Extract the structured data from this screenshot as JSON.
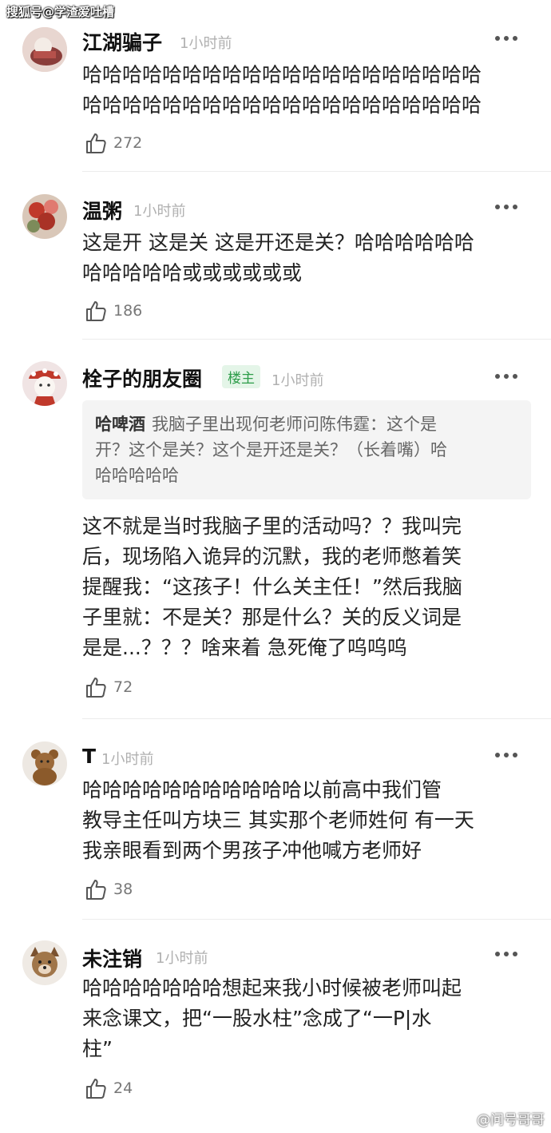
{
  "watermarks": {
    "top": "搜狐号@学渣爱吐槽",
    "bottom": "@问号哥哥"
  },
  "comments": [
    {
      "username": "江湖骗子",
      "time": "1小时前",
      "lines": [
        "哈哈哈哈哈哈哈哈哈哈哈哈哈哈哈哈哈哈哈哈",
        "哈哈哈哈哈哈哈哈哈哈哈哈哈哈哈哈哈哈哈哈"
      ],
      "likes": "272",
      "avatar_icon": "avatar-icon"
    },
    {
      "username": "温粥",
      "time": "1小时前",
      "lines": [
        "这是开 这是关 这是开还是关？哈哈哈哈哈哈",
        "哈哈哈哈哈或或或或或或"
      ],
      "likes": "186",
      "avatar_icon": "avatar-icon"
    },
    {
      "username": "栓子的朋友圈",
      "badge": "楼主",
      "time": "1小时前",
      "quote": {
        "author": "哈啤酒",
        "lines": [
          "我脑子里出现何老师问陈伟霆：这个是",
          "开？这个是关？这个是开还是关？（长着嘴）哈",
          "哈哈哈哈哈"
        ]
      },
      "lines": [
        "这不就是当时我脑子里的活动吗？？我叫完",
        "后，现场陷入诡异的沉默，我的老师憋着笑",
        "提醒我：“这孩子！什么关主任！”然后我脑",
        "子里就：不是关？那是什么？关的反义词是",
        "是是...？？？啥来着 急死俺了呜呜呜"
      ],
      "likes": "72",
      "avatar_icon": "avatar-icon"
    },
    {
      "username": "T",
      "time": "1小时前",
      "lines": [
        "哈哈哈哈哈哈哈哈哈哈哈以前高中我们管",
        "教导主任叫方块三 其实那个老师姓何 有一天",
        "我亲眼看到两个男孩子冲他喊方老师好"
      ],
      "likes": "38",
      "avatar_icon": "avatar-icon"
    },
    {
      "username": "未注销",
      "time": "1小时前",
      "lines": [
        "哈哈哈哈哈哈哈想起来我小时候被老师叫起",
        "来念课文，把“一股水柱”念成了“一P|水",
        "柱”"
      ],
      "likes": "24",
      "avatar_icon": "avatar-icon"
    }
  ],
  "icons": {
    "like": "thumbs-up-icon",
    "more": "more-dots-icon"
  },
  "colors": {
    "badge_green": "#2e9d4a",
    "time_gray": "#b0b0b0"
  }
}
